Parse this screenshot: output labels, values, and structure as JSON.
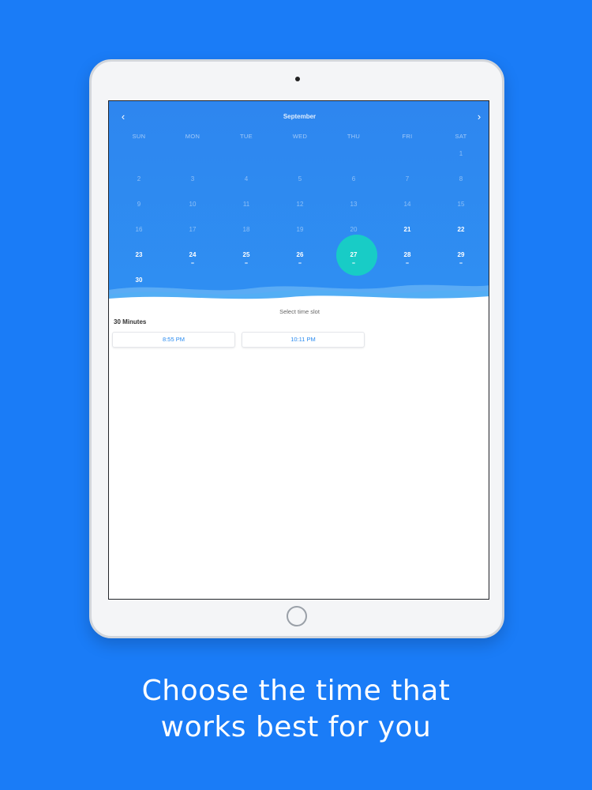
{
  "calendar": {
    "month": "September",
    "prev_icon": "chevron-left-icon",
    "next_icon": "chevron-right-icon",
    "weekdays": [
      "SUN",
      "MON",
      "TUE",
      "WED",
      "THU",
      "FRI",
      "SAT"
    ],
    "selected_day": "27",
    "days": [
      {
        "label": "1",
        "state": "past"
      },
      {
        "label": "2",
        "state": "past"
      },
      {
        "label": "3",
        "state": "past"
      },
      {
        "label": "4",
        "state": "past"
      },
      {
        "label": "5",
        "state": "past"
      },
      {
        "label": "6",
        "state": "past"
      },
      {
        "label": "7",
        "state": "past"
      },
      {
        "label": "8",
        "state": "past"
      },
      {
        "label": "9",
        "state": "past"
      },
      {
        "label": "10",
        "state": "past"
      },
      {
        "label": "11",
        "state": "past"
      },
      {
        "label": "12",
        "state": "past"
      },
      {
        "label": "13",
        "state": "past"
      },
      {
        "label": "14",
        "state": "past"
      },
      {
        "label": "15",
        "state": "past"
      },
      {
        "label": "16",
        "state": "past"
      },
      {
        "label": "17",
        "state": "past"
      },
      {
        "label": "18",
        "state": "past"
      },
      {
        "label": "19",
        "state": "past"
      },
      {
        "label": "20",
        "state": "past"
      },
      {
        "label": "21",
        "state": "avail"
      },
      {
        "label": "22",
        "state": "avail"
      },
      {
        "label": "23",
        "state": "avail"
      },
      {
        "label": "24",
        "state": "avail",
        "dot": true
      },
      {
        "label": "25",
        "state": "avail",
        "dot": true
      },
      {
        "label": "26",
        "state": "avail",
        "dot": true
      },
      {
        "label": "27",
        "state": "selected",
        "dot": true
      },
      {
        "label": "28",
        "state": "avail",
        "dot": true
      },
      {
        "label": "29",
        "state": "avail",
        "dot": true
      },
      {
        "label": "30",
        "state": "avail"
      }
    ]
  },
  "slots": {
    "title": "Select time slot",
    "duration": "30 Minutes",
    "times": [
      "8:55 PM",
      "10:11 PM"
    ]
  },
  "caption": {
    "line1": "Choose the time that",
    "line2": "works best for you"
  },
  "colors": {
    "background": "#1a7cf7",
    "calendar": "#2e86ef",
    "selected": "#18ccc6",
    "slot_text": "#2a8bf0"
  }
}
